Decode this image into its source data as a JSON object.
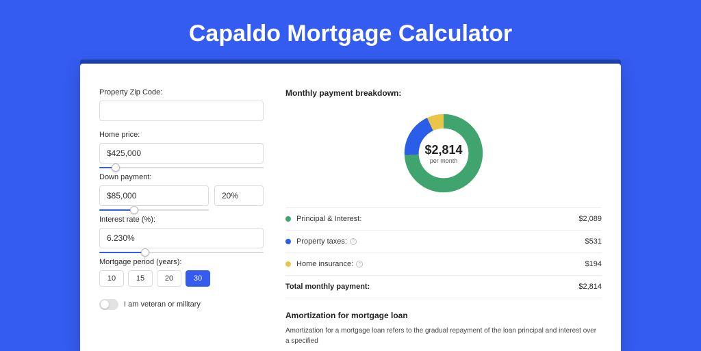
{
  "title": "Capaldo Mortgage Calculator",
  "form": {
    "zip_label": "Property Zip Code:",
    "zip_value": "",
    "home_price_label": "Home price:",
    "home_price_value": "$425,000",
    "home_price_slider_pct": 10,
    "down_label": "Down payment:",
    "down_value": "$85,000",
    "down_pct_value": "20%",
    "down_slider_pct": 32,
    "rate_label": "Interest rate (%):",
    "rate_value": "6.230%",
    "rate_slider_pct": 28,
    "period_label": "Mortgage period (years):",
    "periods": [
      "10",
      "15",
      "20",
      "30"
    ],
    "period_active_index": 3,
    "veteran_label": "I am veteran or military",
    "veteran_on": false
  },
  "breakdown": {
    "heading": "Monthly payment breakdown:",
    "center_amount": "$2,814",
    "center_sub": "per month",
    "items": [
      {
        "label": "Principal & Interest:",
        "value": "$2,089",
        "color": "#40a46f",
        "has_info": false
      },
      {
        "label": "Property taxes:",
        "value": "$531",
        "color": "#2a5de8",
        "has_info": true
      },
      {
        "label": "Home insurance:",
        "value": "$194",
        "color": "#e9c54a",
        "has_info": true
      }
    ],
    "total_label": "Total monthly payment:",
    "total_value": "$2,814"
  },
  "amort": {
    "heading": "Amortization for mortgage loan",
    "body": "Amortization for a mortgage loan refers to the gradual repayment of the loan principal and interest over a specified"
  },
  "chart_data": {
    "type": "pie",
    "title": "Monthly payment breakdown",
    "series": [
      {
        "name": "Principal & Interest",
        "value": 2089,
        "color": "#40a46f"
      },
      {
        "name": "Property taxes",
        "value": 531,
        "color": "#2a5de8"
      },
      {
        "name": "Home insurance",
        "value": 194,
        "color": "#e9c54a"
      }
    ],
    "total": 2814,
    "center_label": "$2,814 per month",
    "donut": true
  }
}
